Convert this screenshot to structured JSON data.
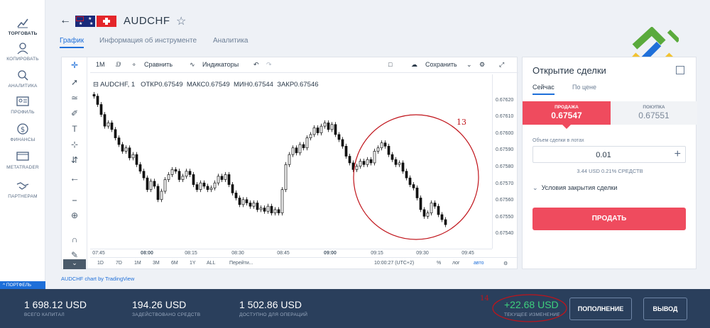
{
  "nav": [
    {
      "label": "ТОРГОВАТЬ",
      "icon": "chart-icon",
      "active": true
    },
    {
      "label": "КОПИРОВАТЬ",
      "icon": "copy-user-icon"
    },
    {
      "label": "АНАЛИТИКА",
      "icon": "analytics-icon"
    },
    {
      "label": "ПРОФИЛЬ",
      "icon": "profile-card-icon"
    },
    {
      "label": "ФИНАНСЫ",
      "icon": "dollar-icon"
    },
    {
      "label": "METATRADER",
      "icon": "monitor-icon"
    },
    {
      "label": "ПАРТНЕРАМ",
      "icon": "handshake-icon"
    }
  ],
  "portfolio_tab": "^ ПОРТФЕЛЬ",
  "header": {
    "title": "AUDCHF"
  },
  "tabs": [
    {
      "label": "График",
      "active": true
    },
    {
      "label": "Информация об инструменте"
    },
    {
      "label": "Аналитика"
    }
  ],
  "toolbar": {
    "interval": "1M",
    "compare": "Сравнить",
    "indicators": "Индикаторы",
    "save": "Сохранить"
  },
  "legend": {
    "symbol": "AUDCHF, 1",
    "open_label": "ОТКР",
    "open": "0.67549",
    "high_label": "МАКС",
    "high": "0.67549",
    "low_label": "МИН",
    "low": "0.67544",
    "close_label": "ЗАКР",
    "close": "0.67546"
  },
  "chart_data": {
    "type": "candlestick",
    "ylim": [
      0.67535,
      0.67625
    ],
    "yticks": [
      "0.67620",
      "0.67610",
      "0.67600",
      "0.67590",
      "0.67580",
      "0.67570",
      "0.67560",
      "0.67550",
      "0.67540"
    ],
    "xticks": [
      {
        "label": "07:45",
        "bold": false
      },
      {
        "label": "08:00",
        "bold": true
      },
      {
        "label": "08:15",
        "bold": false
      },
      {
        "label": "08:30",
        "bold": false
      },
      {
        "label": "08:45",
        "bold": false
      },
      {
        "label": "09:00",
        "bold": true
      },
      {
        "label": "09:15",
        "bold": false
      },
      {
        "label": "09:30",
        "bold": false
      },
      {
        "label": "09:45",
        "bold": false
      }
    ],
    "closes": [
      0.67623,
      0.67618,
      0.67612,
      0.67605,
      0.67607,
      0.67603,
      0.67598,
      0.67594,
      0.6759,
      0.67592,
      0.67586,
      0.67588,
      0.67582,
      0.67578,
      0.67574,
      0.67567,
      0.67572,
      0.67569,
      0.67561,
      0.67566,
      0.67573,
      0.67576,
      0.67579,
      0.67578,
      0.67573,
      0.67575,
      0.67578,
      0.67576,
      0.6757,
      0.67567,
      0.67571,
      0.67569,
      0.67567,
      0.67568,
      0.67571,
      0.67575,
      0.67573,
      0.67576,
      0.6757,
      0.67565,
      0.67562,
      0.67558,
      0.67561,
      0.67559,
      0.67557,
      0.67559,
      0.67555,
      0.67556,
      0.67554,
      0.67557,
      0.67553,
      0.67555,
      0.67553,
      0.67567,
      0.67582,
      0.67588,
      0.67592,
      0.67589,
      0.67594,
      0.67592,
      0.67598,
      0.676,
      0.67604,
      0.67601,
      0.67605,
      0.67607,
      0.67603,
      0.67606,
      0.676,
      0.67597,
      0.67593,
      0.67587,
      0.67583,
      0.67579,
      0.67581,
      0.67584,
      0.67582,
      0.67585,
      0.67583,
      0.6759,
      0.67592,
      0.67595,
      0.67593,
      0.67588,
      0.67585,
      0.67582,
      0.67583,
      0.67578,
      0.67574,
      0.6757,
      0.67568,
      0.67562,
      0.67555,
      0.67551,
      0.67553,
      0.67559,
      0.67557,
      0.67552,
      0.67549,
      0.67546
    ]
  },
  "range": [
    "1D",
    "7D",
    "1М",
    "3М",
    "6М",
    "1Y",
    "ALL",
    "Перейти..."
  ],
  "range_right": {
    "time": "10:00:27 (UTC+2)",
    "pct": "%",
    "log": "лог",
    "auto": "авто"
  },
  "credit": "AUDCHF chart by TradingView",
  "order": {
    "title": "Открытие сделки",
    "tab_now": "Сейчас",
    "tab_price": "По цене",
    "sell_label": "ПРОДАЖА",
    "sell_price": "0.67547",
    "buy_label": "ПОКУПКА",
    "buy_price": "0.67551",
    "volume_label": "Объем сделки в лотах",
    "volume": "0.01",
    "volume_info": "3.44 USD  0.21% СРЕДСТВ",
    "close_conditions": "Условия закрытия сделки",
    "sell_button": "ПРОДАТЬ"
  },
  "bottom": {
    "capital": "1 698.12 USD",
    "capital_label": "ВСЕГО КАПИТАЛ",
    "used": "194.26 USD",
    "used_label": "ЗАДЕЙСТВОВАНО СРЕДСТВ",
    "available": "1 502.86 USD",
    "available_label": "ДОСТУПНО ДЛЯ ОПЕРАЦИЙ",
    "change": "+22.68 USD",
    "change_label": "ТЕКУЩЕЕ ИЗМЕНЕНИЕ",
    "deposit": "ПОПОЛНЕНИЕ",
    "withdraw": "ВЫВОД"
  },
  "annotations": {
    "a13": "13",
    "a14": "14"
  },
  "colors": {
    "accent": "#1e6fd9",
    "sell": "#ef4b5e",
    "bottom_bar": "#2a3f5c",
    "positive": "#3ed07d",
    "annotation": "#c0141b"
  }
}
